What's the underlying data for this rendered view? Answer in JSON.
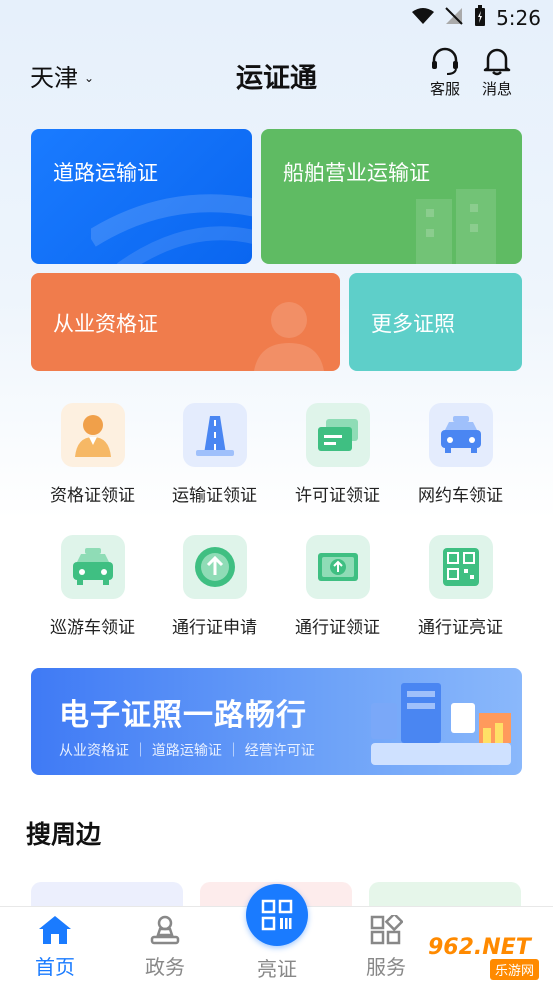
{
  "status_bar": {
    "time": "5:26"
  },
  "header": {
    "city": "天津",
    "title": "运证通",
    "service_label": "客服",
    "message_label": "消息"
  },
  "cards": {
    "road": "道路运输证",
    "ship": "船舶营业运输证",
    "qualification": "从业资格证",
    "more": "更多证照"
  },
  "grid": [
    {
      "label": "资格证领证",
      "icon": "person-icon"
    },
    {
      "label": "运输证领证",
      "icon": "road-icon"
    },
    {
      "label": "许可证领证",
      "icon": "license-icon"
    },
    {
      "label": "网约车领证",
      "icon": "taxi-icon"
    },
    {
      "label": "巡游车领证",
      "icon": "cruise-taxi-icon"
    },
    {
      "label": "通行证申请",
      "icon": "upload-circle-icon"
    },
    {
      "label": "通行证领证",
      "icon": "upload-card-icon"
    },
    {
      "label": "通行证亮证",
      "icon": "qr-code-icon"
    }
  ],
  "banner": {
    "title": "电子证照一路畅行",
    "subtitle": "从业资格证 ｜ 道路运输证 ｜ 经营许可证"
  },
  "section": {
    "title": "搜周边"
  },
  "tabs": {
    "home": "首页",
    "gov": "政务",
    "show": "亮证",
    "service": "服务"
  },
  "watermark": {
    "text": "962.NET",
    "sub": "乐游网"
  },
  "colors": {
    "accent": "#1a7bff",
    "ship": "#5fbb63",
    "qual": "#f07c4c",
    "more": "#5ecfc9"
  }
}
